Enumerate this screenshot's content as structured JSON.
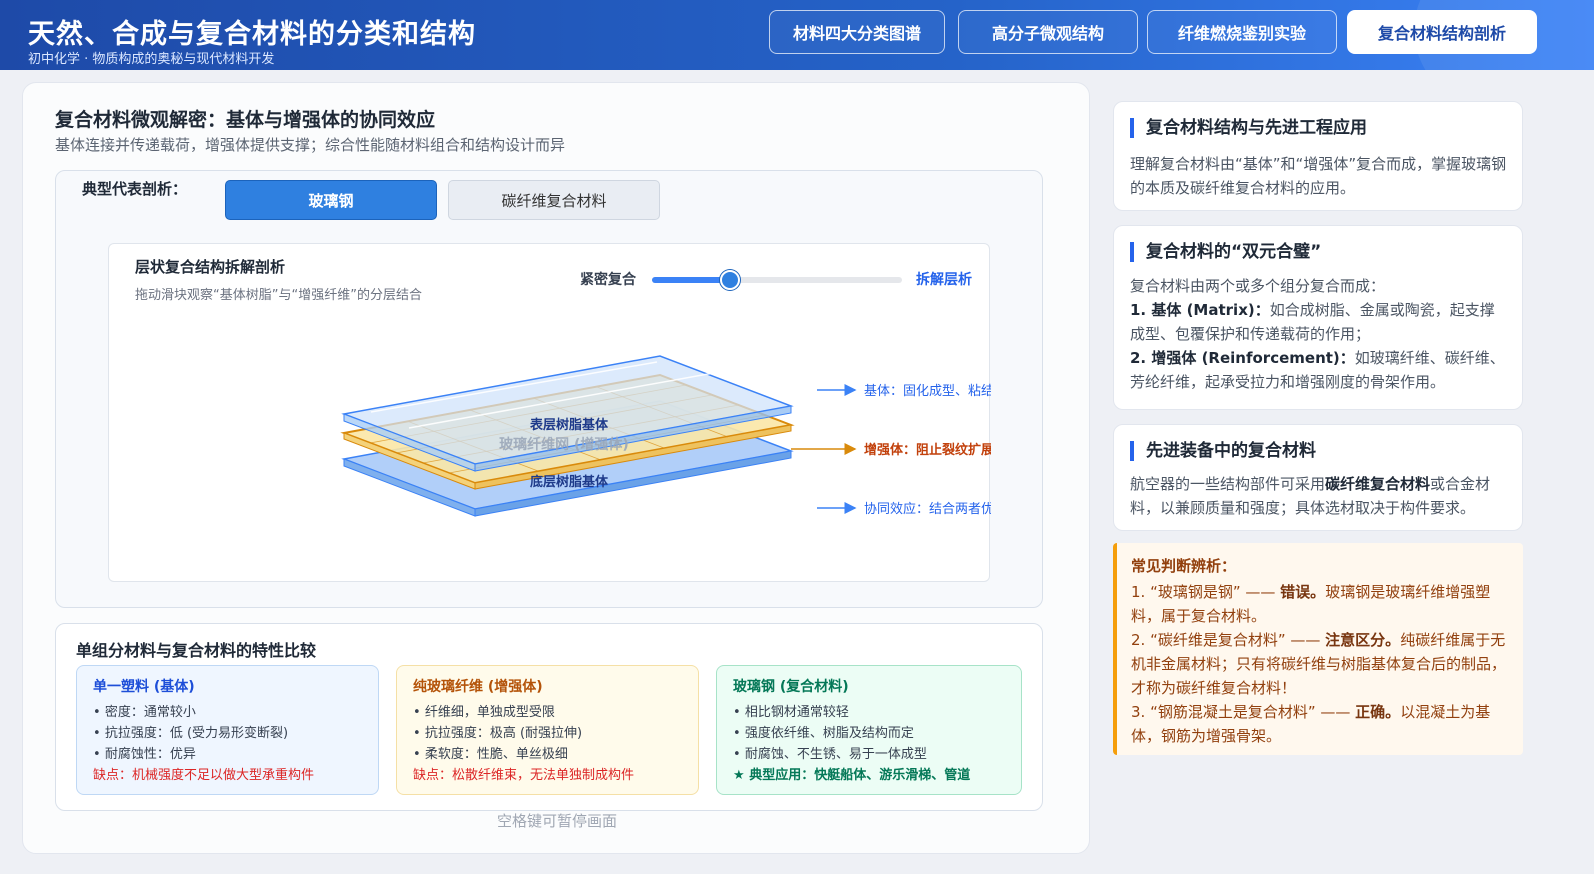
{
  "header": {
    "title": "天然、合成与复合材料的分类和结构",
    "subtitle": "初中化学 · 物质构成的奥秘与现代材料开发",
    "nav": [
      "材料四大分类图谱",
      "高分子微观结构",
      "纤维燃烧鉴别实验",
      "复合材料结构剖析"
    ],
    "active_nav": "复合材料结构剖析"
  },
  "main": {
    "title": "复合材料微观解密：基体与增强体的协同效应",
    "subtitle": "基体连接并传递载荷，增强体提供支撑；综合性能随材料组合和结构设计而异",
    "examples_label": "典型代表剖析：",
    "tabs": [
      "玻璃钢",
      "碳纤维复合材料"
    ],
    "active_tab": "玻璃钢",
    "viz": {
      "title": "层状复合结构拆解剖析",
      "subtitle": "拖动滑块观察“基体树脂”与“增强纤维”的分层结合",
      "slider_left": "紧密复合",
      "slider_right": "拆解层析",
      "slider_value": 0.31,
      "layers": {
        "top": "表层树脂基体",
        "middle": "玻璃纤维网 (增强体)",
        "bottom": "底层树脂基体"
      },
      "annotations": {
        "matrix": "基体：固化成型、粘结传递载荷",
        "reinforcement": "增强体：阻止裂纹扩展，提供高强度",
        "synergy": "协同效应：结合两者优势，性能因设"
      }
    },
    "compare": {
      "title": "单组分材料与复合材料的特性比较",
      "cards": [
        {
          "title": "单一塑料 (基体)",
          "items": [
            "密度：通常较小",
            "抗拉强度：低 (受力易形变断裂)",
            "耐腐蚀性：优异"
          ],
          "note": "缺点：机械强度不足以做大型承重构件"
        },
        {
          "title": "纯玻璃纤维 (增强体)",
          "items": [
            "纤维细，单独成型受限",
            "抗拉强度：极高 (耐强拉伸)",
            "柔软度：性脆、单丝极细"
          ],
          "note": "缺点：松散纤维束，无法单独制成构件"
        },
        {
          "title": "玻璃钢 (复合材料)",
          "items": [
            "相比钢材通常较轻",
            "强度依纤维、树脂及结构而定",
            "耐腐蚀、不生锈、易于一体成型"
          ],
          "note": "典型应用：快艇船体、游乐滑梯、管道"
        }
      ]
    },
    "hint": "空格键可暂停画面"
  },
  "sidebar": {
    "card1": {
      "title": "复合材料结构与先进工程应用",
      "body": "理解复合材料由“基体”和“增强体”复合而成，掌握玻璃钢的本质及碳纤维复合材料的应用。"
    },
    "card2": {
      "title": "复合材料的“双元合璧”",
      "intro": "复合材料由两个或多个组分复合而成：",
      "p1_head": "1. 基体 (Matrix)：",
      "p1_body": "如合成树脂、金属或陶瓷，起支撑成型、包覆保护和传递载荷的作用；",
      "p2_head": "2. 增强体 (Reinforcement)：",
      "p2_body": "如玻璃纤维、碳纤维、芳纶纤维，起承受拉力和增强刚度的骨架作用。"
    },
    "card3": {
      "title": "先进装备中的复合材料",
      "pre": "航空器的一些结构部件可采用",
      "bold": "碳纤维复合材料",
      "post": "或合金材料，以兼顾质量和强度；具体选材取决于构件要求。"
    },
    "warning": {
      "title": "常见判断辨析：",
      "items": [
        {
          "q": "1. “玻璃钢是钢” —— ",
          "verdict": "错误。",
          "text": "玻璃钢是玻璃纤维增强塑料，属于复合材料。"
        },
        {
          "q": "2. “碳纤维是复合材料” —— ",
          "verdict": "注意区分。",
          "text": "纯碳纤维属于无机非金属材料；只有将碳纤维与树脂基体复合后的制品，才称为碳纤维复合材料！"
        },
        {
          "q": "3. “钢筋混凝土是复合材料” —— ",
          "verdict": "正确。",
          "text": "以混凝土为基体，钢筋为增强骨架。"
        }
      ]
    }
  },
  "colors": {
    "primary": "#2563eb",
    "header": "#1e4aa8",
    "reinforcement": "#d98a0b",
    "warning": "#f59e0b"
  }
}
